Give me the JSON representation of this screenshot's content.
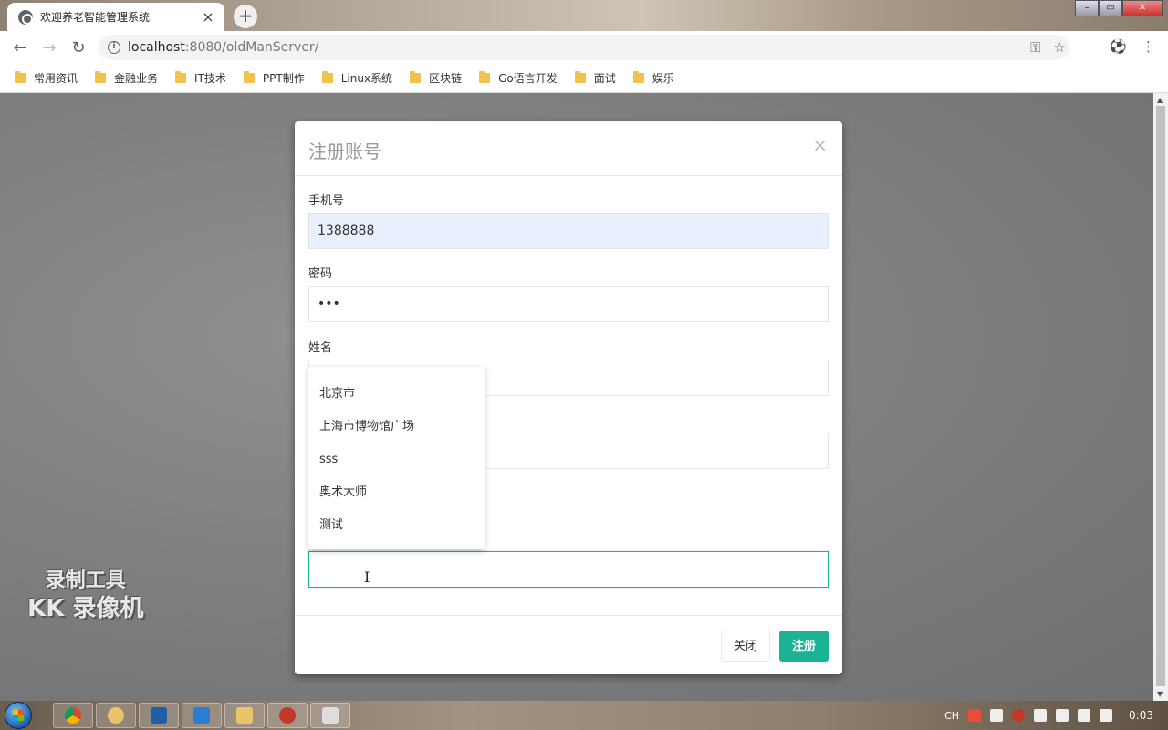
{
  "browser": {
    "tab_title": "欢迎养老智能管理系统",
    "tab_close": "×",
    "new_tab": "+",
    "url_host": "localhost",
    "url_rest": ":8080/oldManServer/",
    "bookmarks": [
      "常用资讯",
      "金融业务",
      "IT技术",
      "PPT制作",
      "Linux系统",
      "区块链",
      "Go语言开发",
      "面试",
      "娱乐"
    ]
  },
  "watermark": {
    "line1": "录制工具",
    "line2": "KK 录像机"
  },
  "modal": {
    "title": "注册账号",
    "close": "×",
    "fields": {
      "phone": {
        "label": "手机号",
        "value": "1388888"
      },
      "password": {
        "label": "密码",
        "value": "•••"
      },
      "name": {
        "label": "姓名",
        "value": ""
      },
      "fourth": {
        "value": ""
      },
      "address": {
        "value": ""
      }
    },
    "dropdown_options": [
      "北京市",
      "上海市博物馆广场",
      "sss",
      "奥术大师",
      "测试"
    ],
    "buttons": {
      "close": "关闭",
      "submit": "注册"
    }
  },
  "taskbar": {
    "tray_lang": "CH",
    "clock": "0:03"
  },
  "colors": {
    "accent": "#1ab394",
    "autofill": "#e8f0fe",
    "folder": "#f2c14e"
  }
}
